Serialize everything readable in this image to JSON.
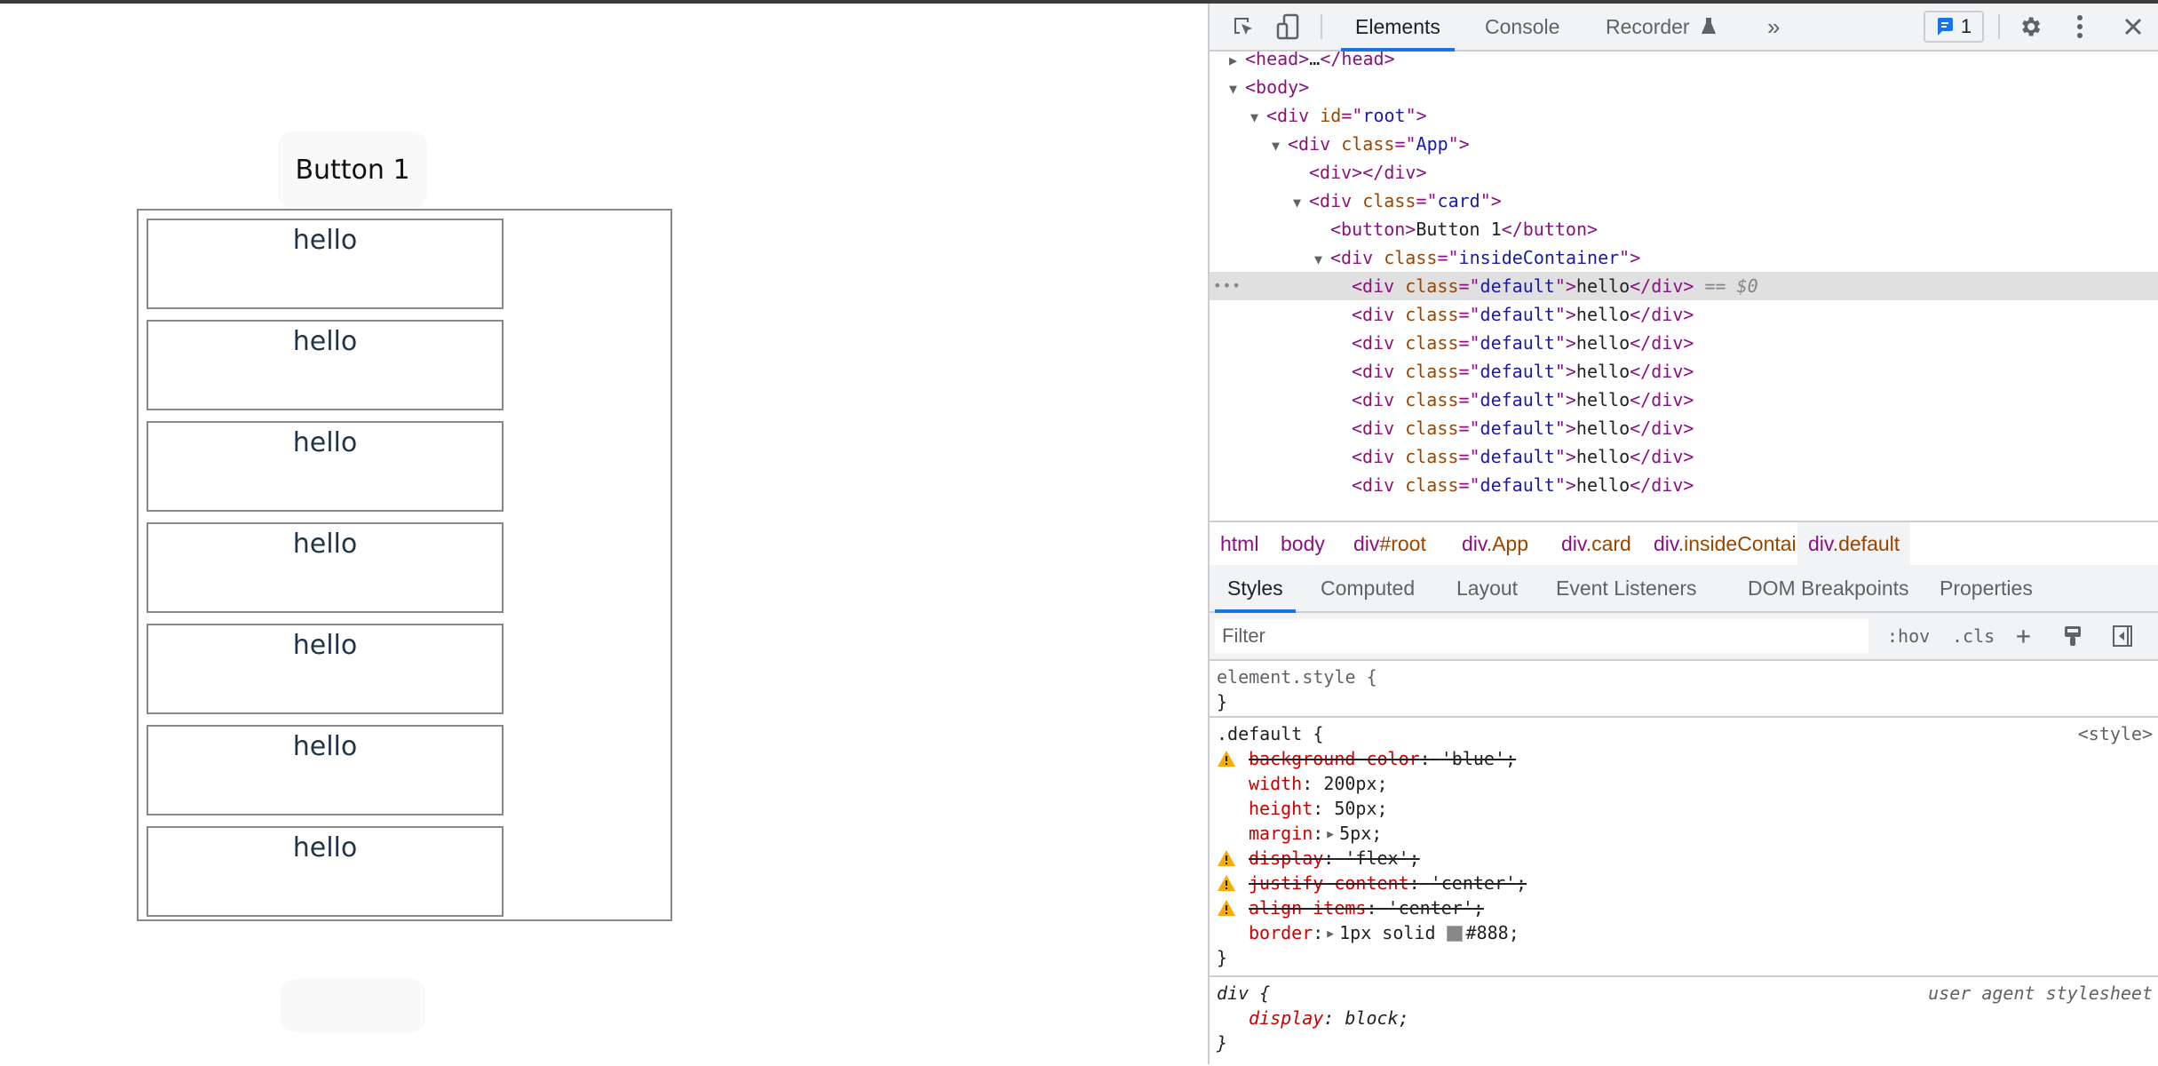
{
  "page": {
    "button1_label": "Button 1",
    "hello_items": [
      "hello",
      "hello",
      "hello",
      "hello",
      "hello",
      "hello",
      "hello"
    ],
    "button2_label": ""
  },
  "devtools": {
    "toolbar": {
      "tabs": [
        "Elements",
        "Console",
        "Recorder"
      ],
      "active_tab": "Elements",
      "more_tabs_glyph": "»",
      "issues_count": "1",
      "icons": [
        "inspect-element-icon",
        "device-toolbar-icon",
        "recorder-flask-icon",
        "issues-chat-icon",
        "settings-gear-icon",
        "more-vertical-icon",
        "close-icon"
      ]
    },
    "dom_tree": [
      {
        "indent": 1,
        "toggle": "collapsed",
        "tag": "head",
        "collapsed_text": "…",
        "close": "head"
      },
      {
        "indent": 1,
        "toggle": "expanded",
        "tag": "body"
      },
      {
        "indent": 2,
        "toggle": "expanded",
        "tag": "div",
        "attr": "id",
        "value": "root"
      },
      {
        "indent": 3,
        "toggle": "expanded",
        "tag": "div",
        "attr": "class",
        "value": "App"
      },
      {
        "indent": 4,
        "toggle": "none",
        "tag": "div",
        "close": "div"
      },
      {
        "indent": 4,
        "toggle": "expanded",
        "tag": "div",
        "attr": "class",
        "value": "card"
      },
      {
        "indent": 5,
        "toggle": "none",
        "tag": "button",
        "text": "Button 1",
        "close": "button"
      },
      {
        "indent": 5,
        "toggle": "expanded",
        "tag": "div",
        "attr": "class",
        "value": "insideContainer"
      },
      {
        "indent": 6,
        "toggle": "none",
        "tag": "div",
        "attr": "class",
        "value": "default",
        "text": "hello",
        "close": "div",
        "selected": true,
        "suffix": "== $0"
      },
      {
        "indent": 6,
        "toggle": "none",
        "tag": "div",
        "attr": "class",
        "value": "default",
        "text": "hello",
        "close": "div"
      },
      {
        "indent": 6,
        "toggle": "none",
        "tag": "div",
        "attr": "class",
        "value": "default",
        "text": "hello",
        "close": "div"
      },
      {
        "indent": 6,
        "toggle": "none",
        "tag": "div",
        "attr": "class",
        "value": "default",
        "text": "hello",
        "close": "div"
      },
      {
        "indent": 6,
        "toggle": "none",
        "tag": "div",
        "attr": "class",
        "value": "default",
        "text": "hello",
        "close": "div"
      },
      {
        "indent": 6,
        "toggle": "none",
        "tag": "div",
        "attr": "class",
        "value": "default",
        "text": "hello",
        "close": "div"
      },
      {
        "indent": 6,
        "toggle": "none",
        "tag": "div",
        "attr": "class",
        "value": "default",
        "text": "hello",
        "close": "div"
      },
      {
        "indent": 6,
        "toggle": "none",
        "tag": "div",
        "attr": "class",
        "value": "default",
        "text": "hello",
        "close": "div"
      }
    ],
    "breadcrumbs": [
      {
        "tag": "html",
        "cls": ""
      },
      {
        "tag": "body",
        "cls": ""
      },
      {
        "tag": "div",
        "cls": "#root"
      },
      {
        "tag": "div",
        "cls": ".App"
      },
      {
        "tag": "div",
        "cls": ".card"
      },
      {
        "tag": "div",
        "cls": ".insideContainer"
      },
      {
        "tag": "div",
        "cls": ".default",
        "selected": true
      }
    ],
    "styles_tabs": [
      "Styles",
      "Computed",
      "Layout",
      "Event Listeners",
      "DOM Breakpoints",
      "Properties"
    ],
    "styles_active_tab": "Styles",
    "filter": {
      "placeholder": "Filter",
      "value": ""
    },
    "filter_tools": {
      "hov": ":hov",
      "cls": ".cls",
      "add": "+"
    },
    "rules": {
      "element_style": {
        "selector": "element.style {",
        "close": "}"
      },
      "default_rule": {
        "selector": ".default {",
        "source": "<style>",
        "close": "}",
        "declarations": [
          {
            "prop": "background-color",
            "value": "'blue'",
            "invalid": true
          },
          {
            "prop": "width",
            "value": "200px"
          },
          {
            "prop": "height",
            "value": "50px"
          },
          {
            "prop": "margin",
            "value": "5px",
            "expandable": true
          },
          {
            "prop": "display",
            "value": "'flex'",
            "invalid": true
          },
          {
            "prop": "justify-content",
            "value": "'center'",
            "invalid": true
          },
          {
            "prop": "align-items",
            "value": "'center'",
            "invalid": true
          },
          {
            "prop": "border",
            "value": "1px solid",
            "color": "#888",
            "expandable": true
          }
        ]
      },
      "ua_rule": {
        "selector": "div {",
        "source": "user agent stylesheet",
        "prop": "display",
        "value": "block",
        "close": "}"
      }
    },
    "colors": {
      "accent": "#1a73e8",
      "tag": "#881280",
      "attr_name": "#994500",
      "attr_value": "#1a1aa6",
      "prop": "#c80000",
      "warning": "#f9ab00",
      "border_swatch": "#888888"
    }
  }
}
